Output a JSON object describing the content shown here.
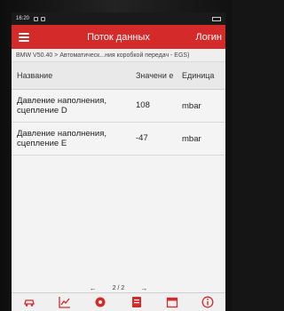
{
  "status": {
    "time": "16:20"
  },
  "appbar": {
    "title": "Поток данных",
    "login_label": "Логин"
  },
  "breadcrumb": "BMW V50.40 > Автоматическ...ния коробкой передач - EGS)",
  "table": {
    "headers": {
      "name": "Название",
      "value": "Значени е",
      "unit": "Единица"
    },
    "rows": [
      {
        "name": "Давление наполнения, сцепление D",
        "value": "108",
        "unit": "mbar"
      },
      {
        "name": "Давление наполнения, сцепление E",
        "value": "-47",
        "unit": "mbar"
      }
    ]
  },
  "pager": {
    "label": "2 / 2"
  },
  "toolbar": {
    "icons": [
      "car-icon",
      "chart-icon",
      "settings-icon",
      "record-icon",
      "calendar-icon",
      "info-icon"
    ]
  },
  "colors": {
    "accent": "#d42a2a"
  }
}
